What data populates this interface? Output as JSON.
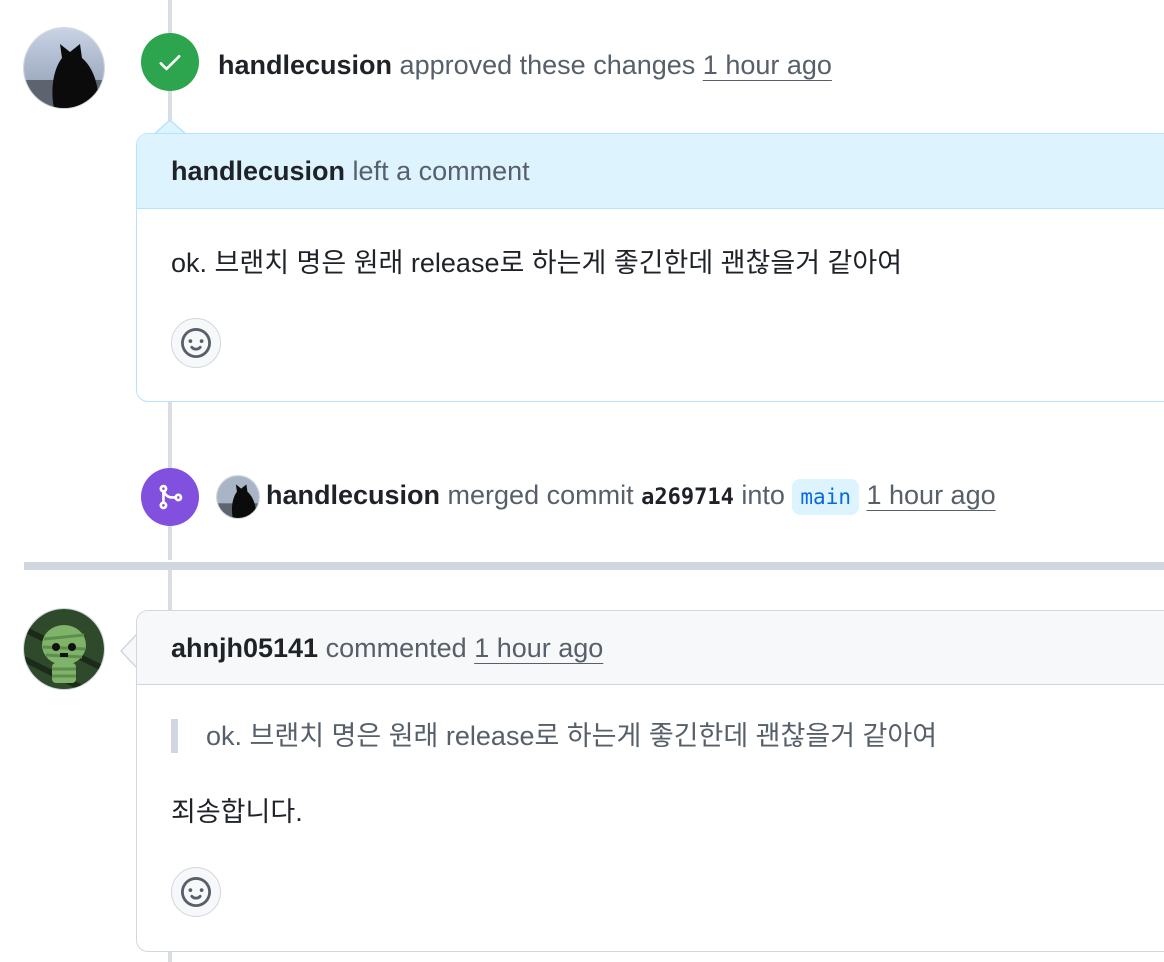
{
  "review_event": {
    "author": "handlecusion",
    "action": "approved these changes",
    "time": "1 hour ago",
    "badge_icon": "check-icon",
    "badge_color": "#2da44e"
  },
  "review_comment": {
    "author": "handlecusion",
    "header_action": "left a comment",
    "body": "ok. 브랜치 명은 원래 release로 하는게 좋긴한데 괜찮을거 같아여",
    "header_bg": "#ddf4ff",
    "border_color": "#b6e3ff",
    "reaction_icon": "smiley-icon"
  },
  "merge_event": {
    "author": "handlecusion",
    "action": "merged commit",
    "commit_sha": "a269714",
    "into_word": "into",
    "branch": "main",
    "time": "1 hour ago",
    "badge_icon": "git-merge-icon",
    "badge_color": "#8250df"
  },
  "comment": {
    "author": "ahnjh05141",
    "action": "commented",
    "time": "1 hour ago",
    "quote": "ok. 브랜치 명은 원래 release로 하는게 좋긴한데 괜찮을거 같아여",
    "body": "죄송합니다.",
    "reaction_icon": "smiley-icon"
  }
}
